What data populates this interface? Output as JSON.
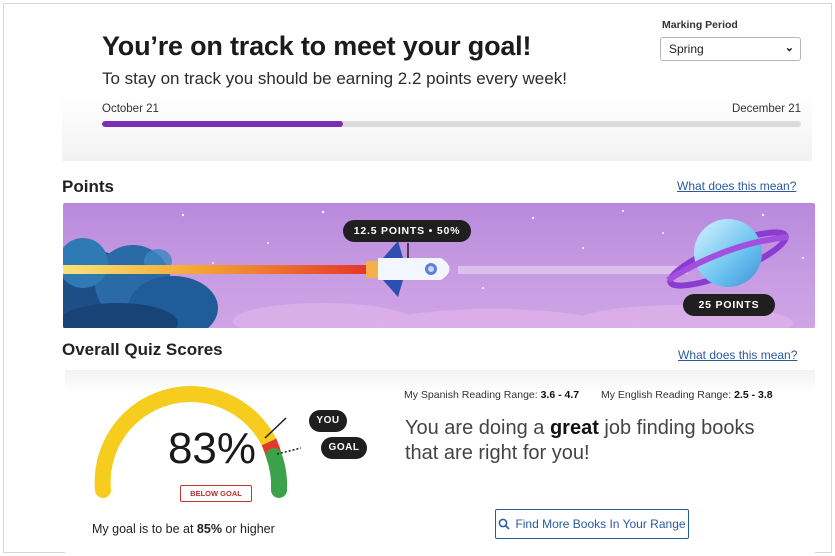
{
  "goal": {
    "title": "You’re on track to meet your goal!",
    "subtitle": "To stay on track you should be earning 2.2 points every week!",
    "start_date": "October 21",
    "end_date": "December 21",
    "progress_fraction": 0.345,
    "marking_period_label": "Marking Period",
    "marking_period_value": "Spring"
  },
  "points": {
    "title": "Points",
    "help_link": "What does this mean?",
    "current_label": "12.5 POINTS • 50%",
    "goal_label": "25 POINTS",
    "current_points": 12.5,
    "goal_points": 25,
    "percent": 50
  },
  "quiz": {
    "title": "Overall Quiz Scores",
    "help_link": "What does this mean?",
    "score_text": "83%",
    "score": 83,
    "goal_score": 85,
    "status_badge": "BELOW GOAL",
    "you_tag": "YOU",
    "goal_tag": "GOAL",
    "goal_line_prefix": "My goal is to be at ",
    "goal_line_value": "85%",
    "goal_line_suffix": " or higher",
    "spanish_range_label": "My Spanish Reading Range: ",
    "spanish_range_value": "3.6 - 4.7",
    "english_range_label": "My English Reading Range: ",
    "english_range_value": "2.5 - 3.8",
    "praise_prefix": "You are doing a ",
    "praise_emphasis": "great",
    "praise_suffix": " job finding books that are right for you!",
    "find_button_label": "Find More Books In Your Range",
    "find_button_icon": "search-icon"
  },
  "colors": {
    "accent_purple": "#7a2fb5",
    "link_blue": "#2a5a9e",
    "gauge_yellow": "#f6cc1f",
    "gauge_red": "#e03b2a",
    "gauge_green": "#3aa24a",
    "banner_purple": "#c79be2"
  }
}
